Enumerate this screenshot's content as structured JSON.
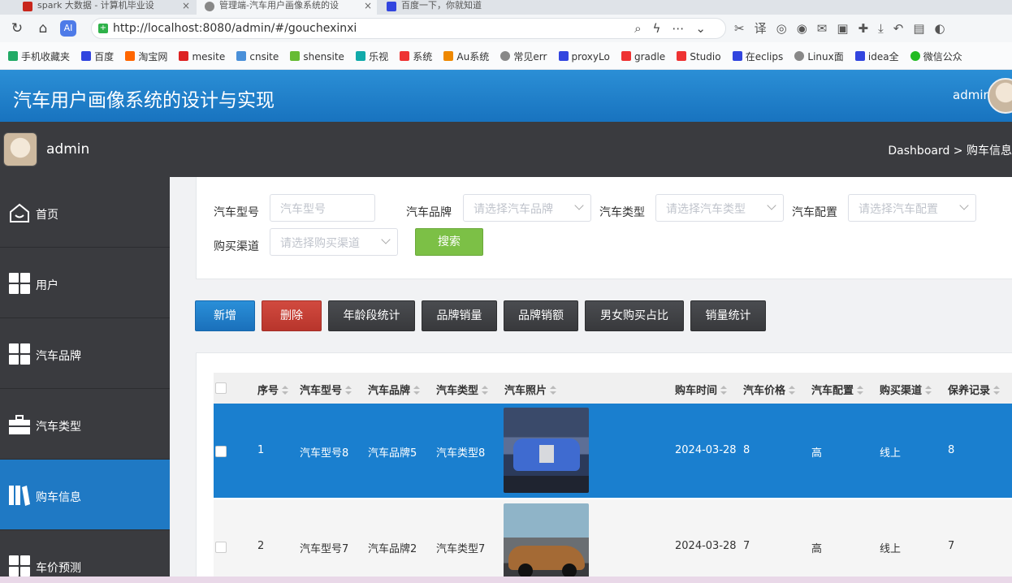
{
  "browser": {
    "tabs": [
      {
        "title": "spark 大数据 - 计算机毕业设"
      },
      {
        "title": "管理端-汽车用户画像系统的设"
      },
      {
        "title": "百度一下，你就知道"
      }
    ],
    "url": "http://localhost:8080/admin/#/gouchexinxi",
    "bookmarks": [
      "手机收藏夹",
      "百度",
      "淘宝网",
      "mesite",
      "cnsite",
      "shensite",
      "乐视",
      "系统",
      "Au系统",
      "常见err",
      "proxyLo",
      "gradle",
      "Studio",
      "在eclips",
      "Linux面",
      "idea全",
      "微信公众"
    ]
  },
  "header": {
    "title": "汽车用户画像系统的设计与实现",
    "user": "admin"
  },
  "subheader": {
    "user": "admin",
    "breadcrumb": "Dashboard > 购车信息"
  },
  "sidebar": {
    "items": [
      {
        "label": "首页",
        "icon": "home-icon"
      },
      {
        "label": "用户",
        "icon": "grid-icon"
      },
      {
        "label": "汽车品牌",
        "icon": "grid-icon"
      },
      {
        "label": "汽车类型",
        "icon": "briefcase-icon"
      },
      {
        "label": "购车信息",
        "icon": "book-icon",
        "active": true
      },
      {
        "label": "车价预测",
        "icon": "grid-icon"
      }
    ]
  },
  "search": {
    "model_label": "汽车型号",
    "model_placeholder": "汽车型号",
    "brand_label": "汽车品牌",
    "brand_placeholder": "请选择汽车品牌",
    "type_label": "汽车类型",
    "type_placeholder": "请选择汽车类型",
    "config_label": "汽车配置",
    "config_placeholder": "请选择汽车配置",
    "channel_label": "购买渠道",
    "channel_placeholder": "请选择购买渠道",
    "search_button": "搜索"
  },
  "actions": {
    "add": "新增",
    "delete": "删除",
    "age_stats": "年龄段统计",
    "brand_sales": "品牌销量",
    "brand_revenue": "品牌销额",
    "gender_ratio": "男女购买占比",
    "sales_stats": "销量统计"
  },
  "table": {
    "headers": [
      "序号",
      "汽车型号",
      "汽车品牌",
      "汽车类型",
      "汽车照片",
      "购车时间",
      "汽车价格",
      "汽车配置",
      "购买渠道",
      "保养记录"
    ],
    "rows": [
      {
        "no": "1",
        "model": "汽车型号8",
        "brand": "汽车品牌5",
        "type": "汽车类型8",
        "photo": "blue-luxury-sedan",
        "date": "2024-03-28",
        "price": "8",
        "config": "高",
        "channel": "线上",
        "maintenance": "8"
      },
      {
        "no": "2",
        "model": "汽车型号7",
        "brand": "汽车品牌2",
        "type": "汽车类型7",
        "photo": "bronze-supercar",
        "date": "2024-03-28",
        "price": "7",
        "config": "高",
        "channel": "线上",
        "maintenance": "7"
      }
    ]
  },
  "colors": {
    "header_blue": "#1f7fcc",
    "sidebar_dark": "#3a3b3f",
    "active_blue": "#1f79c4",
    "delete_red": "#c6402f",
    "search_green": "#7cc046"
  }
}
